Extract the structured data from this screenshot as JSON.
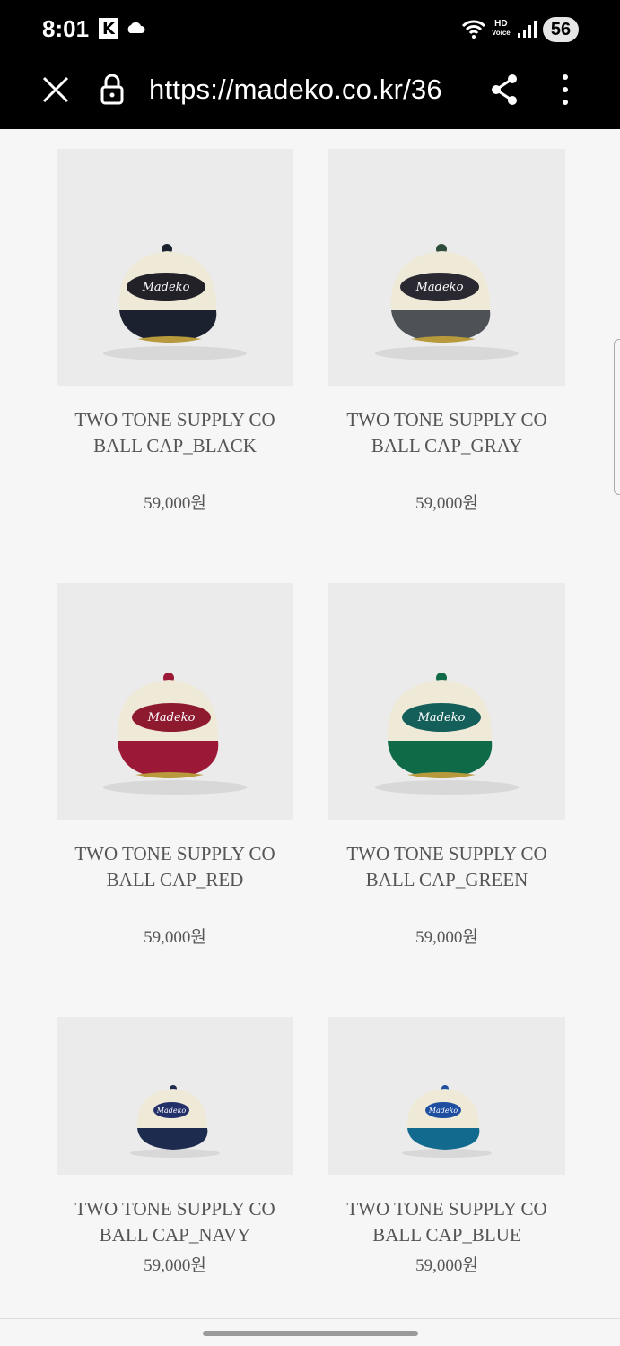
{
  "status_bar": {
    "time": "8:01",
    "k_badge": "K",
    "hd_line1": "HD",
    "hd_line2": "Voice",
    "battery": "56"
  },
  "browser": {
    "url": "https://madeko.co.kr/36"
  },
  "products": [
    {
      "name_line1": "TWO TONE SUPPLY CO",
      "name_line2": "BALL CAP_BLACK",
      "price": "59,000원",
      "brim_color": "#1c2130",
      "patch_color": "#232128",
      "logo": "Madeko"
    },
    {
      "name_line1": "TWO TONE SUPPLY CO",
      "name_line2": "BALL CAP_GRAY",
      "price": "59,000원",
      "brim_color": "#4e5256",
      "patch_color": "#2a2830",
      "logo": "Madeko"
    },
    {
      "name_line1": "TWO TONE SUPPLY CO",
      "name_line2": "BALL CAP_RED",
      "price": "59,000원",
      "brim_color": "#9b1836",
      "patch_color": "#8e1a30",
      "logo": "Madeko"
    },
    {
      "name_line1": "TWO TONE SUPPLY CO",
      "name_line2": "BALL CAP_GREEN",
      "price": "59,000원",
      "brim_color": "#0f6a48",
      "patch_color": "#155f5a",
      "logo": "Madeko"
    },
    {
      "name_line1": "TWO TONE SUPPLY CO",
      "name_line2": "BALL CAP_NAVY",
      "price": "59,000원",
      "brim_color": "#1d2b4f",
      "patch_color": "#23306a",
      "logo": "Madeko"
    },
    {
      "name_line1": "TWO TONE SUPPLY CO",
      "name_line2": "BALL CAP_BLUE",
      "price": "59,000원",
      "brim_color": "#126a8e",
      "patch_color": "#1e4ea0",
      "logo": "Madeko"
    }
  ]
}
